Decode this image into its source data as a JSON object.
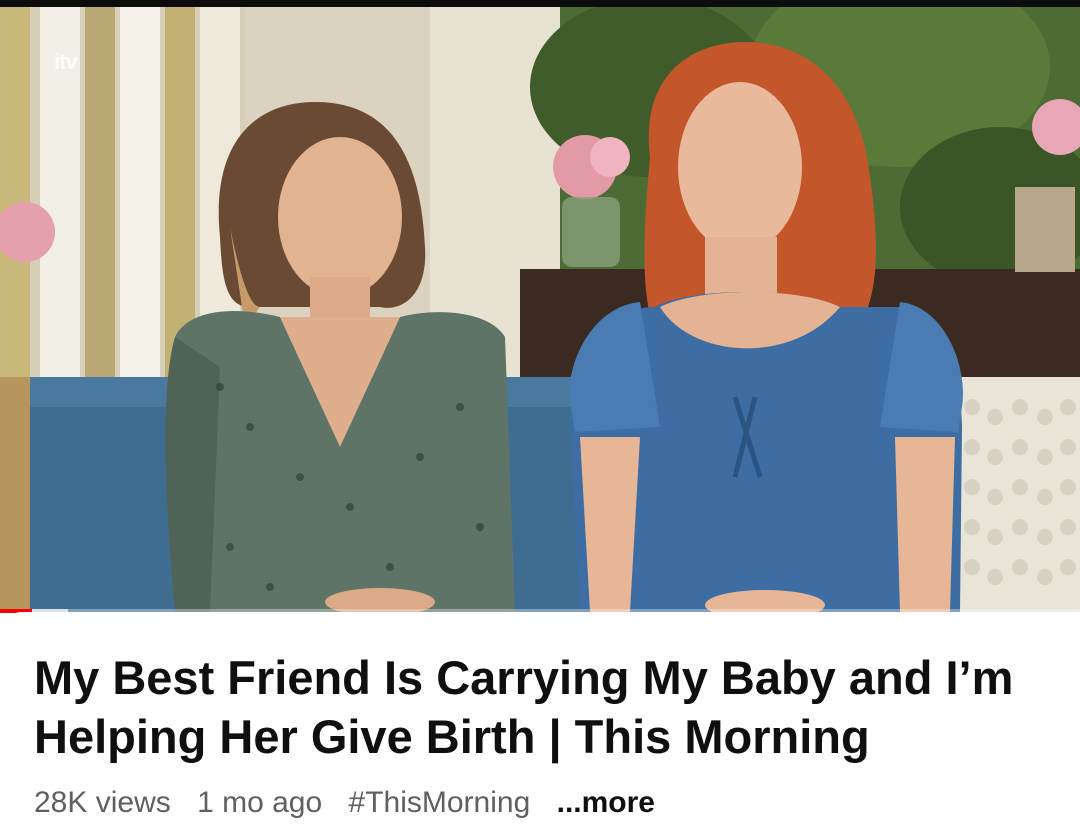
{
  "video": {
    "channel_logo_text": "itv",
    "progress_fraction": 0.03,
    "buffer_fraction": 0.063
  },
  "details": {
    "title": "My Best Friend Is Carrying My Baby and I’m Helping Her Give Birth | This Morning",
    "views": "28K views",
    "age": "1 mo ago",
    "hashtag": "#ThisMorning",
    "more_label": "...more"
  },
  "colors": {
    "progress": "#ff0000",
    "title_text": "#0f0f0f",
    "meta_text": "#606060"
  }
}
